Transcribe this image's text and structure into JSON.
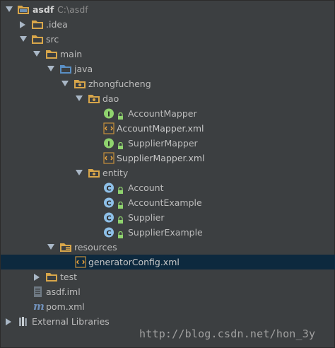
{
  "project": {
    "name": "asdf",
    "path": "C:\\asdf"
  },
  "tree": {
    "idea": ".idea",
    "src": "src",
    "main": "main",
    "java": "java",
    "package": "zhongfucheng",
    "dao": "dao",
    "account_mapper": "AccountMapper",
    "account_mapper_xml": "AccountMapper.xml",
    "supplier_mapper": "SupplierMapper",
    "supplier_mapper_xml": "SupplierMapper.xml",
    "entity": "entity",
    "account": "Account",
    "account_example": "AccountExample",
    "supplier": "Supplier",
    "supplier_example": "SupplierExample",
    "resources": "resources",
    "generator_config": "generatorConfig.xml",
    "test": "test",
    "iml": "asdf.iml",
    "pom": "pom.xml",
    "external_libraries": "External Libraries"
  },
  "icon_letters": {
    "interface": "I",
    "class": "C",
    "maven": "m"
  },
  "colors": {
    "background": "#3c3f41",
    "selection": "#0d293e",
    "folder": "#d8a64a",
    "interface_badge": "#8fd36e",
    "class_badge": "#8ec0e8",
    "xml_badge": "#e8a23c"
  },
  "watermark": "http://blog.csdn.net/hon_3y"
}
